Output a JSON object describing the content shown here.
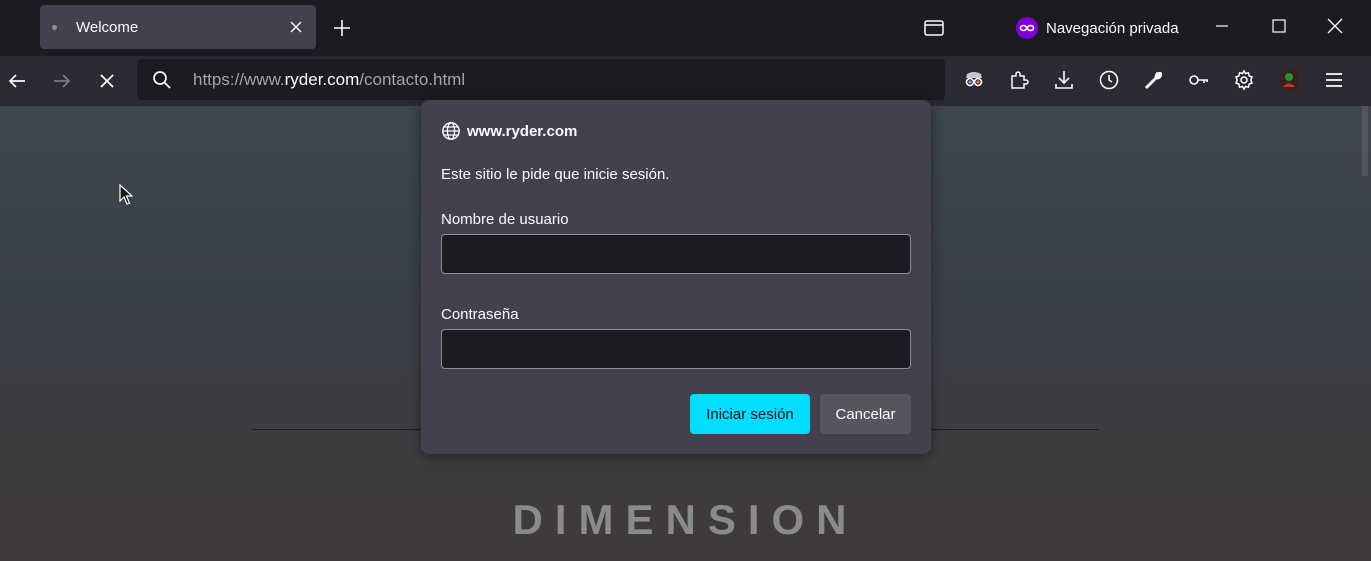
{
  "window": {
    "tab_title": "Welcome",
    "private_label": "Navegación privada"
  },
  "navbar": {
    "url_scheme": "https://www.",
    "url_host": "ryder.com",
    "url_path": "/contacto.html"
  },
  "page": {
    "brand": "DIMENSION"
  },
  "dialog": {
    "site": "www.ryder.com",
    "message": "Este sitio le pide que inicie sesión.",
    "username_label": "Nombre de usuario",
    "username_value": "",
    "password_label": "Contraseña",
    "password_value": "",
    "submit_label": "Iniciar sesión",
    "cancel_label": "Cancelar"
  },
  "colors": {
    "accent": "#00ddff",
    "private_purple": "#8000d7"
  }
}
